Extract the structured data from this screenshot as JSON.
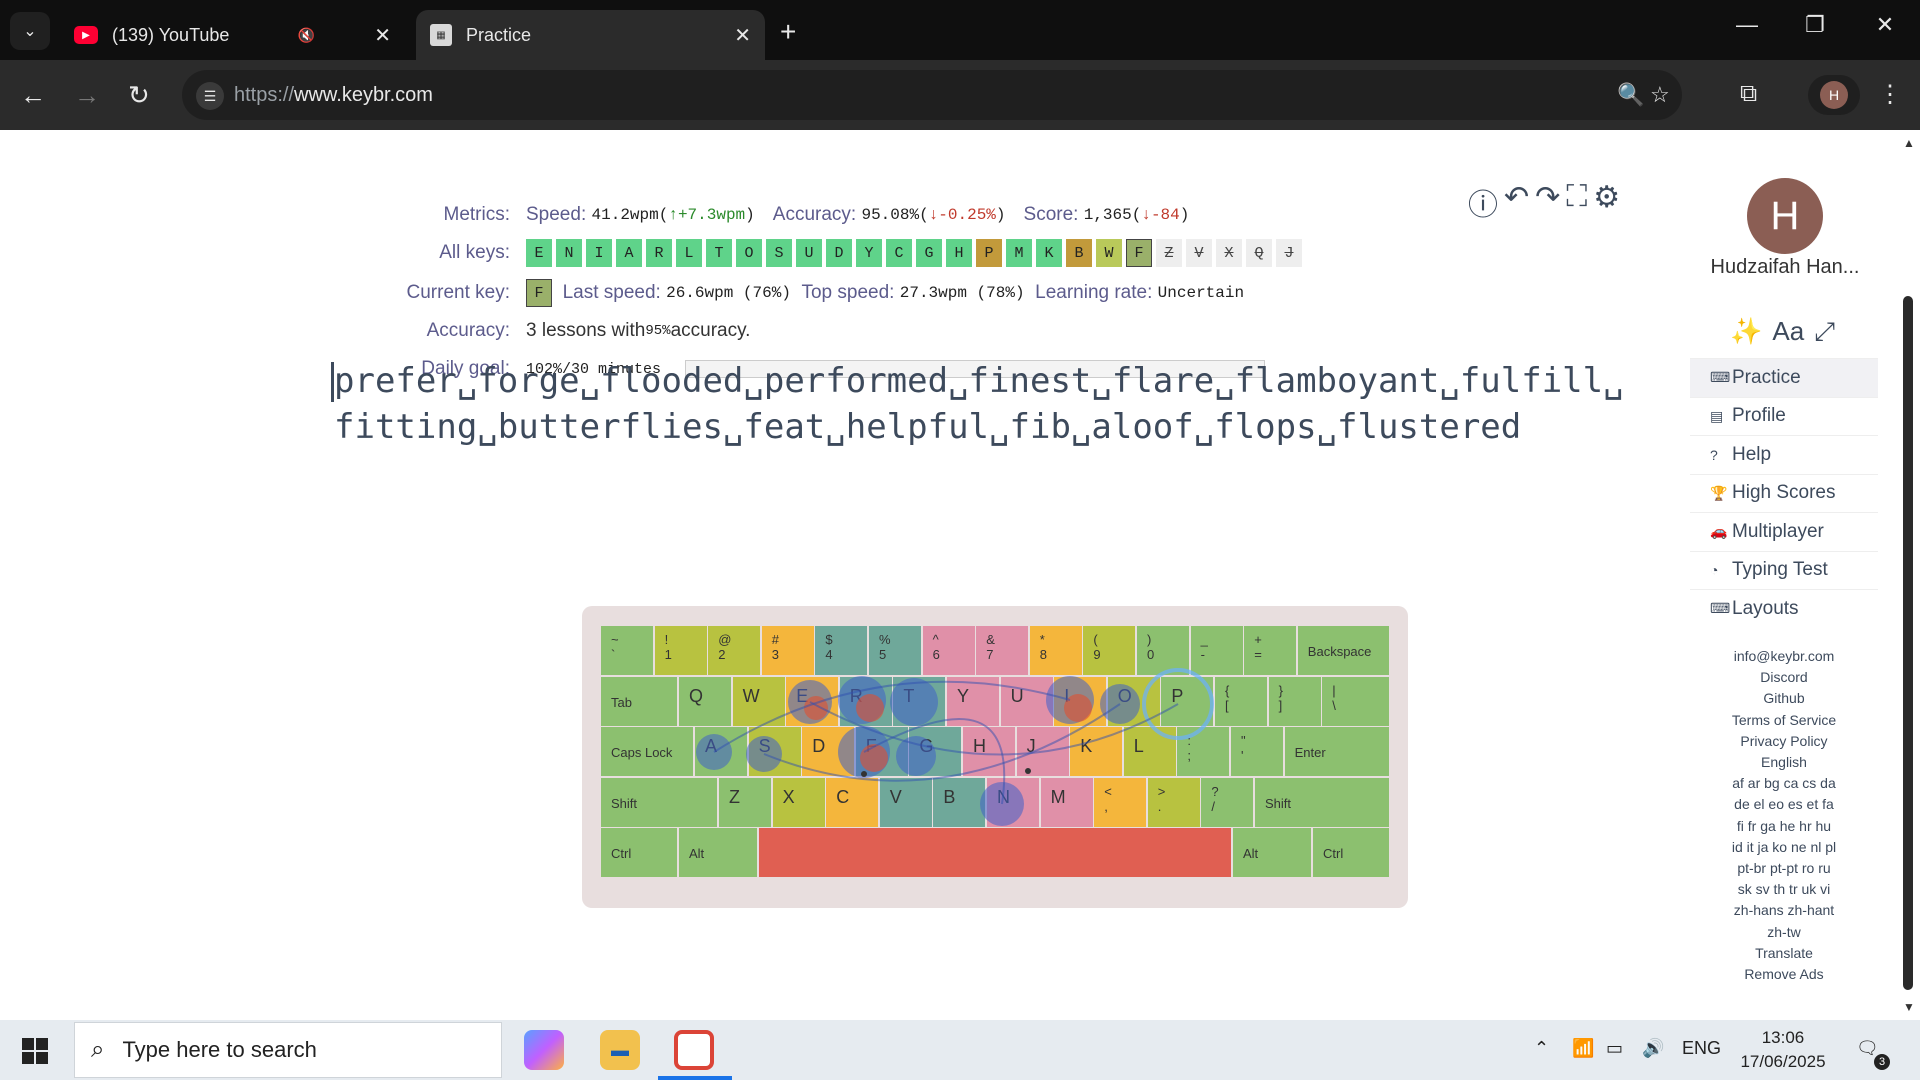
{
  "browser": {
    "tabs": [
      {
        "title": "(139) YouTube",
        "active": false,
        "favicon": "youtube-icon"
      },
      {
        "title": "Practice",
        "active": true,
        "favicon": "keybr-icon"
      }
    ],
    "url_scheme": "https://",
    "url_host": "www.keybr.com",
    "profile_initial": "H"
  },
  "metrics": {
    "labels": {
      "metrics": "Metrics:",
      "all_keys": "All keys:",
      "current_key": "Current key:",
      "accuracy": "Accuracy:",
      "daily_goal": "Daily goal:"
    },
    "speed_label": "Speed:",
    "speed_value": "41.2wpm",
    "speed_open": "(",
    "speed_delta": "↑+7.3wpm",
    "speed_close": ")",
    "accuracy_label": "Accuracy:",
    "accuracy_value": "95.08%",
    "accuracy_open": "(",
    "accuracy_delta": "↓-0.25%",
    "accuracy_close": ")",
    "score_label": "Score:",
    "score_value": "1,365",
    "score_open": "(",
    "score_delta": "↓-84",
    "score_close": ")",
    "keys": [
      {
        "k": "E",
        "s": "g"
      },
      {
        "k": "N",
        "s": "g"
      },
      {
        "k": "I",
        "s": "g"
      },
      {
        "k": "A",
        "s": "g"
      },
      {
        "k": "R",
        "s": "g"
      },
      {
        "k": "L",
        "s": "g"
      },
      {
        "k": "T",
        "s": "g"
      },
      {
        "k": "O",
        "s": "g"
      },
      {
        "k": "S",
        "s": "g"
      },
      {
        "k": "U",
        "s": "g"
      },
      {
        "k": "D",
        "s": "g"
      },
      {
        "k": "Y",
        "s": "g"
      },
      {
        "k": "C",
        "s": "g"
      },
      {
        "k": "G",
        "s": "g"
      },
      {
        "k": "H",
        "s": "g"
      },
      {
        "k": "P",
        "s": "o"
      },
      {
        "k": "M",
        "s": "g"
      },
      {
        "k": "K",
        "s": "g"
      },
      {
        "k": "B",
        "s": "o"
      },
      {
        "k": "W",
        "s": "y"
      },
      {
        "k": "F",
        "s": "f"
      },
      {
        "k": "Z",
        "s": "x"
      },
      {
        "k": "V",
        "s": "x"
      },
      {
        "k": "X",
        "s": "x"
      },
      {
        "k": "Q",
        "s": "x"
      },
      {
        "k": "J",
        "s": "x"
      }
    ],
    "current_key": "F",
    "last_speed_label": "Last speed:",
    "last_speed_value": "26.6wpm (76%)",
    "top_speed_label": "Top speed:",
    "top_speed_value": "27.3wpm (78%)",
    "learning_rate_label": "Learning rate:",
    "learning_rate_value": "Uncertain",
    "accuracy_text_pre": "3 lessons with ",
    "accuracy_text_pct": "95%",
    "accuracy_text_post": " accuracy.",
    "daily_goal_value": "102%/30 minutes",
    "daily_goal_progress": 1.0
  },
  "practice_text": {
    "line1": "prefer␣forge␣flooded␣performed␣finest␣flare␣flamboyant␣fulfill␣",
    "line2": "fitting␣butterflies␣feat␣helpful␣fib␣aloof␣flops␣flustered"
  },
  "keyboard": {
    "row1": [
      {
        "t": "~",
        "b": "`",
        "c": "cg"
      },
      {
        "t": "!",
        "b": "1",
        "c": "cy"
      },
      {
        "t": "@",
        "b": "2",
        "c": "cy"
      },
      {
        "t": "#",
        "b": "3",
        "c": "co"
      },
      {
        "t": "$",
        "b": "4",
        "c": "ct"
      },
      {
        "t": "%",
        "b": "5",
        "c": "ct"
      },
      {
        "t": "^",
        "b": "6",
        "c": "cp"
      },
      {
        "t": "&",
        "b": "7",
        "c": "cp"
      },
      {
        "t": "*",
        "b": "8",
        "c": "co"
      },
      {
        "t": "(",
        "b": "9",
        "c": "cy"
      },
      {
        "t": ")",
        "b": "0",
        "c": "cg"
      },
      {
        "t": "_",
        "b": "-",
        "c": "cg"
      },
      {
        "t": "+",
        "b": "=",
        "c": "cg"
      }
    ],
    "backspace": "Backspace",
    "tab": "Tab",
    "row2": [
      {
        "t": "Q",
        "c": "cg"
      },
      {
        "t": "W",
        "c": "cy"
      },
      {
        "t": "E",
        "c": "co"
      },
      {
        "t": "R",
        "c": "ct"
      },
      {
        "t": "T",
        "c": "ct"
      },
      {
        "t": "Y",
        "c": "cp"
      },
      {
        "t": "U",
        "c": "cp"
      },
      {
        "t": "I",
        "c": "co"
      },
      {
        "t": "O",
        "c": "cy"
      },
      {
        "t": "P",
        "c": "cg"
      }
    ],
    "row2_sym": [
      {
        "t": "{",
        "b": "[",
        "c": "cg"
      },
      {
        "t": "}",
        "b": "]",
        "c": "cg"
      },
      {
        "t": "|",
        "b": "\\",
        "c": "cg"
      }
    ],
    "caps": "Caps Lock",
    "row3": [
      {
        "t": "A",
        "c": "cg"
      },
      {
        "t": "S",
        "c": "cy"
      },
      {
        "t": "D",
        "c": "co"
      },
      {
        "t": "F",
        "c": "ct"
      },
      {
        "t": "G",
        "c": "ct"
      },
      {
        "t": "H",
        "c": "cp"
      },
      {
        "t": "J",
        "c": "cp"
      },
      {
        "t": "K",
        "c": "co"
      },
      {
        "t": "L",
        "c": "cy"
      }
    ],
    "row3_sym": [
      {
        "t": ":",
        "b": ";",
        "c": "cg"
      },
      {
        "t": "\"",
        "b": "'",
        "c": "cg"
      }
    ],
    "enter": "Enter",
    "shift": "Shift",
    "row4": [
      {
        "t": "Z",
        "c": "cg"
      },
      {
        "t": "X",
        "c": "cy"
      },
      {
        "t": "C",
        "c": "co"
      },
      {
        "t": "V",
        "c": "ct"
      },
      {
        "t": "B",
        "c": "ct"
      },
      {
        "t": "N",
        "c": "cp"
      },
      {
        "t": "M",
        "c": "cp"
      }
    ],
    "row4_sym": [
      {
        "t": "<",
        "b": ",",
        "c": "co"
      },
      {
        "t": ">",
        "b": ".",
        "c": "cy"
      },
      {
        "t": "?",
        "b": "/",
        "c": "cg"
      }
    ],
    "ctrl": "Ctrl",
    "alt": "Alt"
  },
  "sidebar": {
    "avatar_initial": "H",
    "user_name": "Hudzaifah Han...",
    "menu": [
      {
        "label": "Practice",
        "icon": "keyboard-icon"
      },
      {
        "label": "Profile",
        "icon": "chart-icon"
      },
      {
        "label": "Help",
        "icon": "help-icon"
      },
      {
        "label": "High Scores",
        "icon": "trophy-icon"
      },
      {
        "label": "Multiplayer",
        "icon": "car-icon"
      },
      {
        "label": "Typing Test",
        "icon": "gauge-icon"
      },
      {
        "label": "Layouts",
        "icon": "keyboard-icon"
      }
    ],
    "footer": [
      "info@keybr.com",
      "Discord",
      "Github",
      "Terms of Service",
      "Privacy Policy",
      "English",
      "af ar bg ca cs da",
      "de el eo es et fa",
      "fi fr ga he hr hu",
      "id it ja ko ne nl pl",
      "pt-br pt-pt ro ru",
      "sk sv th tr uk vi",
      "zh-hans zh-hant",
      "zh-tw",
      "Translate",
      "Remove Ads"
    ]
  },
  "taskbar": {
    "search_placeholder": "Type here to search",
    "lang": "ENG",
    "time": "13:06",
    "date": "17/06/2025",
    "notifications": "3"
  },
  "colors": {
    "accent_text": "#5c5b8c",
    "key_green": "#5fd38a",
    "space_red": "#e05f52"
  }
}
